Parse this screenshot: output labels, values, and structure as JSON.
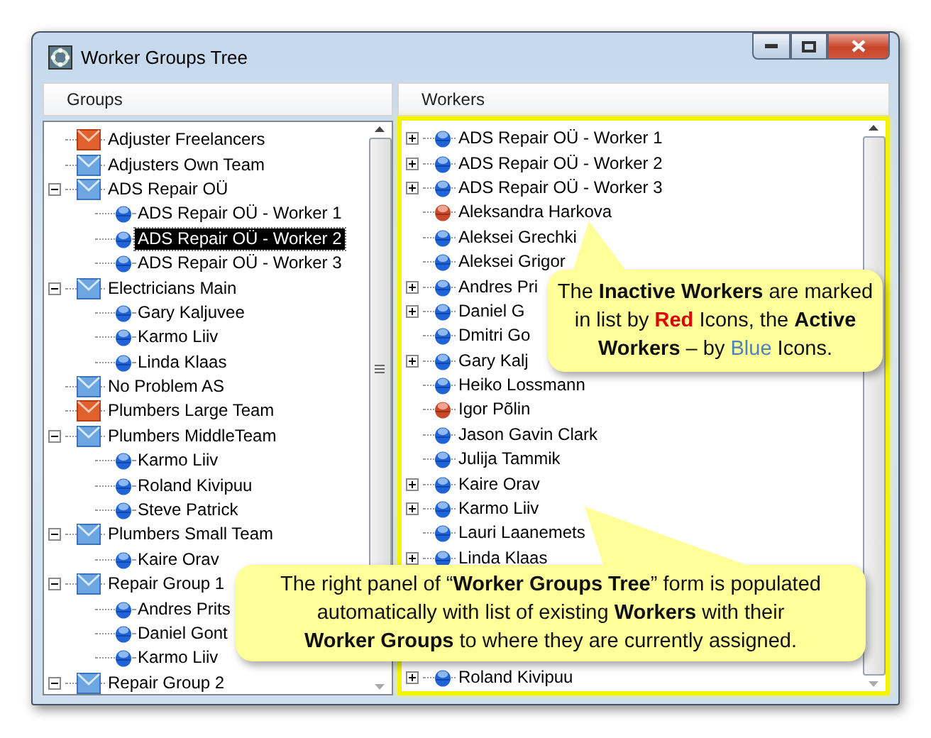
{
  "window": {
    "title": "Worker Groups Tree"
  },
  "groups_panel": {
    "header": "Groups",
    "items": [
      {
        "label": "Adjuster Freelancers",
        "active": false
      },
      {
        "label": "Adjusters Own Team",
        "active": true
      },
      {
        "label": "ADS Repair OÜ",
        "active": true,
        "expanded": true,
        "children": [
          {
            "label": "ADS Repair OÜ - Worker 1",
            "active": true,
            "selected": false
          },
          {
            "label": "ADS Repair OÜ - Worker 2",
            "active": true,
            "selected": true
          },
          {
            "label": "ADS Repair OÜ - Worker 3",
            "active": true,
            "selected": false
          }
        ]
      },
      {
        "label": "Electricians Main",
        "active": true,
        "expanded": true,
        "children": [
          {
            "label": "Gary Kaljuvee",
            "active": true,
            "selected": false
          },
          {
            "label": "Karmo Liiv",
            "active": true,
            "selected": false
          },
          {
            "label": "Linda Klaas",
            "active": true,
            "selected": false
          }
        ]
      },
      {
        "label": "No Problem AS",
        "active": true
      },
      {
        "label": "Plumbers Large Team",
        "active": false
      },
      {
        "label": "Plumbers MiddleTeam",
        "active": true,
        "expanded": true,
        "children": [
          {
            "label": "Karmo Liiv",
            "active": true,
            "selected": false
          },
          {
            "label": "Roland Kivipuu",
            "active": true,
            "selected": false
          },
          {
            "label": "Steve Patrick",
            "active": true,
            "selected": false
          }
        ]
      },
      {
        "label": "Plumbers Small Team",
        "active": true,
        "expanded": true,
        "children": [
          {
            "label": "Kaire Orav",
            "active": true,
            "selected": false
          }
        ]
      },
      {
        "label": "Repair Group 1",
        "active": true,
        "expanded": true,
        "children": [
          {
            "label": "Andres Prits",
            "active": true,
            "selected": false
          },
          {
            "label": "Daniel Gont",
            "active": true,
            "selected": false
          },
          {
            "label": "Karmo Liiv",
            "active": true,
            "selected": false
          }
        ]
      },
      {
        "label": "Repair Group 2",
        "active": true,
        "expanded": true
      }
    ]
  },
  "workers_panel": {
    "header": "Workers",
    "items": [
      {
        "label": "ADS Repair OÜ - Worker 1",
        "active": true,
        "expandable": true
      },
      {
        "label": "ADS Repair OÜ - Worker 2",
        "active": true,
        "expandable": true
      },
      {
        "label": "ADS Repair OÜ - Worker 3",
        "active": true,
        "expandable": true
      },
      {
        "label": "Aleksandra Harkova",
        "active": false,
        "expandable": false
      },
      {
        "label": "Aleksei Grechki",
        "active": true,
        "expandable": false
      },
      {
        "label": "Aleksei Grigor",
        "active": true,
        "expandable": false
      },
      {
        "label": "Andres Pri",
        "active": true,
        "expandable": true
      },
      {
        "label": "Daniel G",
        "active": true,
        "expandable": true
      },
      {
        "label": "Dmitri Go",
        "active": true,
        "expandable": false
      },
      {
        "label": "Gary Kalj",
        "active": true,
        "expandable": true
      },
      {
        "label": "Heiko Lossmann",
        "active": true,
        "expandable": false
      },
      {
        "label": "Igor Põlin",
        "active": false,
        "expandable": false
      },
      {
        "label": "Jason Gavin Clark",
        "active": true,
        "expandable": false
      },
      {
        "label": "Julija Tammik",
        "active": true,
        "expandable": false
      },
      {
        "label": "Kaire Orav",
        "active": true,
        "expandable": true
      },
      {
        "label": "Karmo Liiv",
        "active": true,
        "expandable": true
      },
      {
        "label": "Lauri Laanemets",
        "active": true,
        "expandable": false
      },
      {
        "label": "Linda Klaas",
        "active": true,
        "expandable": true
      },
      {
        "label": "Roland Kivipuu",
        "active": true,
        "expandable": true,
        "after_gap": true
      }
    ]
  },
  "callouts": [
    {
      "lines": [
        [
          {
            "kind": "plain",
            "text": "The "
          },
          {
            "kind": "bold",
            "text": "Inactive Workers"
          },
          {
            "kind": "plain",
            "text": " are marked"
          }
        ],
        [
          {
            "kind": "plain",
            "text": "in list by "
          },
          {
            "kind": "red",
            "text": "Red"
          },
          {
            "kind": "plain",
            "text": " Icons, the "
          },
          {
            "kind": "bold",
            "text": "Active"
          }
        ],
        [
          {
            "kind": "bold",
            "text": "Workers"
          },
          {
            "kind": "plain",
            "text": " – by "
          },
          {
            "kind": "blue",
            "text": "Blue"
          },
          {
            "kind": "plain",
            "text": " Icons."
          }
        ]
      ]
    },
    {
      "lines": [
        [
          {
            "kind": "plain",
            "text": "The right panel of “"
          },
          {
            "kind": "bold",
            "text": "Worker Groups Tree"
          },
          {
            "kind": "plain",
            "text": "” form is populated"
          }
        ],
        [
          {
            "kind": "plain",
            "text": "automatically with list of existing "
          },
          {
            "kind": "bold",
            "text": "Workers"
          },
          {
            "kind": "plain",
            "text": " with their"
          }
        ],
        [
          {
            "kind": "bold",
            "text": "Worker Groups"
          },
          {
            "kind": "plain",
            "text": " to where they are currently assigned."
          }
        ]
      ]
    }
  ]
}
